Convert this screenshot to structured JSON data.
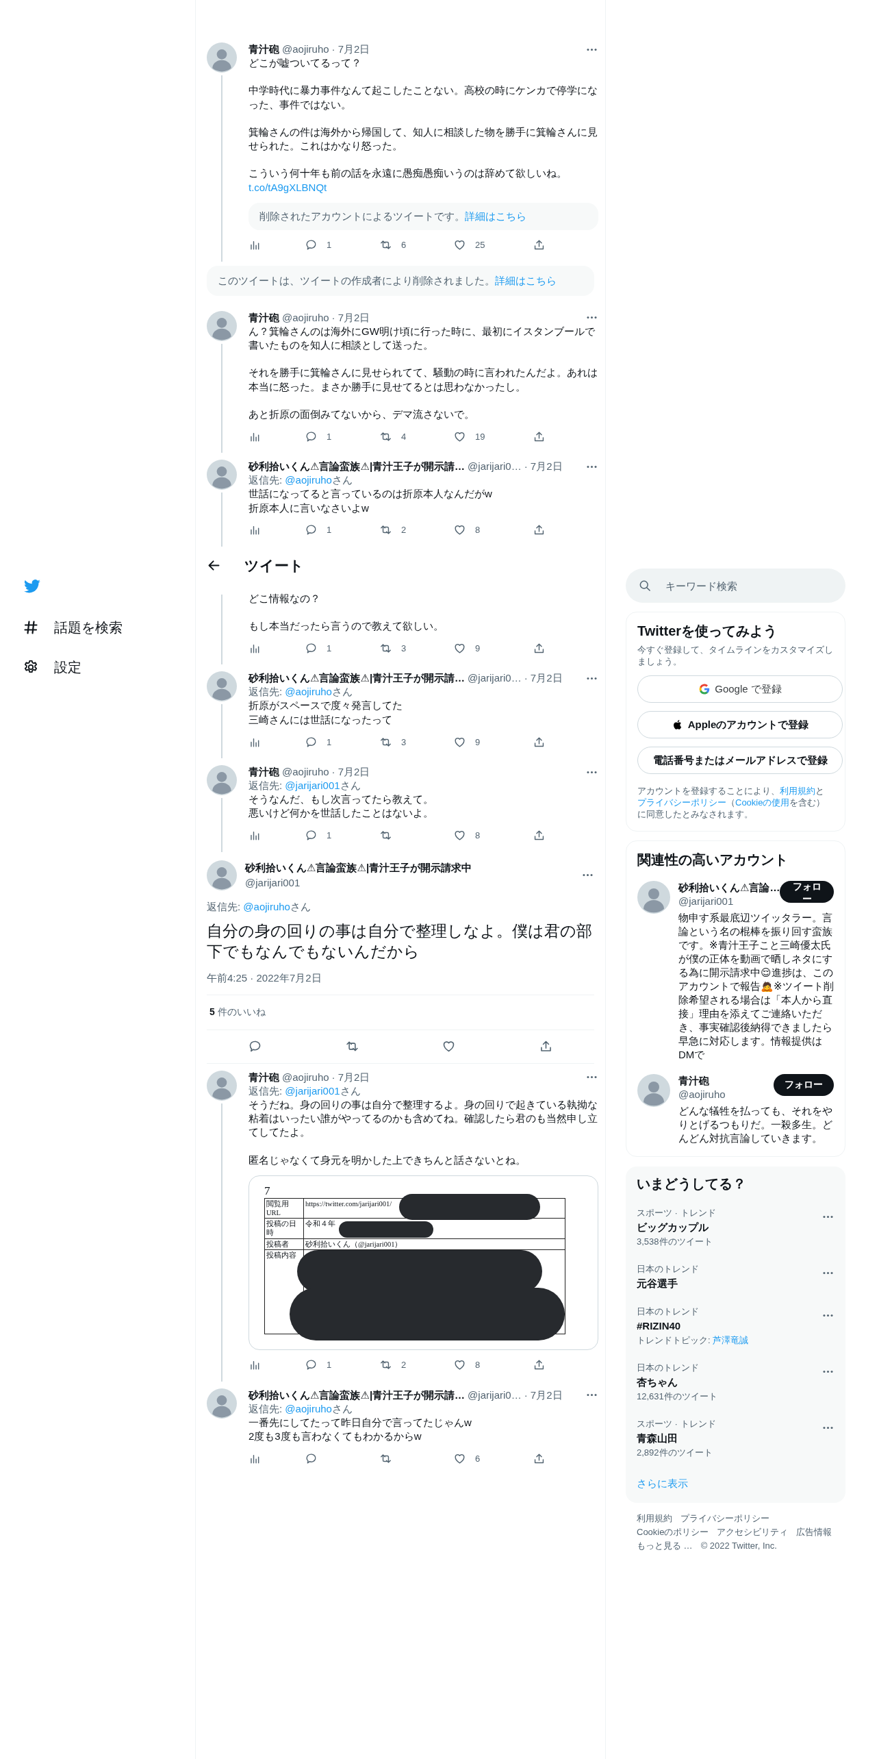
{
  "nav": {
    "items": [
      {
        "kind": "hashtag",
        "label": "話題を検索"
      },
      {
        "kind": "gear",
        "label": "設定"
      }
    ]
  },
  "main": {
    "items": [
      {
        "kind": "tweet",
        "name": "青汁砲",
        "handle": "@aojiruho",
        "date": "· 7月2日",
        "body": [
          [
            "どこが嘘ついてるって？"
          ],
          [
            "中学時代に暴力事件なんて起こしたことない。高校の時にケンカで停学になった、事件ではない。"
          ],
          [
            "箕輪さんの件は海外から帰国して、知人に相談した物を勝手に箕輪さんに見せられた。これはかなり怒った。"
          ],
          [
            "こういう何十年も前の話を永遠に愚痴愚痴いうのは辞めて欲しいね。"
          ]
        ],
        "link": "t.co/tA9gXLBNQt",
        "quote": {
          "text": "削除されたアカウントによるツイートです。",
          "link": "詳細はこちら"
        },
        "thread_line": true,
        "actions": [
          {
            "kind": "analytics"
          },
          {
            "kind": "reply",
            "count": "1"
          },
          {
            "kind": "retweet",
            "count": "6"
          },
          {
            "kind": "like",
            "count": "25"
          },
          {
            "kind": "share"
          }
        ]
      },
      {
        "kind": "notice",
        "text": "このツイートは、ツイートの作成者により削除されました。",
        "link": "詳細はこちら"
      },
      {
        "kind": "tweet",
        "name": "青汁砲",
        "handle": "@aojiruho",
        "date": "· 7月2日",
        "body": [
          [
            "ん？箕輪さんのは海外にGW明け頃に行った時に、最初にイスタンブールで書いたものを知人に相談として送った。"
          ],
          [
            "それを勝手に箕輪さんに見せられてて、騒動の時に言われたんだよ。あれは本当に怒った。まさか勝手に見せてるとは思わなかったし。"
          ],
          [
            "あと折原の面倒みてないから、デマ流さないで。"
          ]
        ],
        "thread_line": true,
        "actions": [
          {
            "kind": "analytics"
          },
          {
            "kind": "reply",
            "count": "1"
          },
          {
            "kind": "retweet",
            "count": "4"
          },
          {
            "kind": "like",
            "count": "19"
          },
          {
            "kind": "share"
          }
        ]
      },
      {
        "kind": "tweet",
        "name": "砂利拾いくん⚠言論蛮族⚠|青汁王子が開示請…",
        "handle": "@jarijari0…",
        "date": "· 7月2日",
        "reply_to": {
          "prefix": "返信先: ",
          "handle": "@aojiruho",
          "suffix": "さん"
        },
        "body": [
          [
            "世話になってると言っているのは折原本人なんだがw",
            "折原本人に言いなさいよw"
          ]
        ],
        "thread_line": true,
        "actions": [
          {
            "kind": "analytics"
          },
          {
            "kind": "reply",
            "count": "1"
          },
          {
            "kind": "retweet",
            "count": "2"
          },
          {
            "kind": "like",
            "count": "8"
          },
          {
            "kind": "share"
          }
        ]
      },
      {
        "kind": "header",
        "title": "ツイート"
      },
      {
        "kind": "tweet",
        "body": [
          [
            "どこ情報なの？"
          ],
          [
            "もし本当だったら言うので教えて欲しい。"
          ]
        ],
        "thread_line": true,
        "actions": [
          {
            "kind": "analytics"
          },
          {
            "kind": "reply",
            "count": "1"
          },
          {
            "kind": "retweet",
            "count": "3"
          },
          {
            "kind": "like",
            "count": "9"
          },
          {
            "kind": "share"
          }
        ]
      },
      {
        "kind": "tweet",
        "name": "砂利拾いくん⚠言論蛮族⚠|青汁王子が開示請…",
        "handle": "@jarijari0…",
        "date": "· 7月2日",
        "reply_to": {
          "prefix": "返信先: ",
          "handle": "@aojiruho",
          "suffix": "さん"
        },
        "body": [
          [
            "折原がスペースで度々発言してた",
            "三崎さんには世話になったって"
          ]
        ],
        "thread_line": true,
        "actions": [
          {
            "kind": "analytics"
          },
          {
            "kind": "reply",
            "count": "1"
          },
          {
            "kind": "retweet",
            "count": "3"
          },
          {
            "kind": "like",
            "count": "9"
          },
          {
            "kind": "share"
          }
        ]
      },
      {
        "kind": "tweet",
        "name": "青汁砲",
        "handle": "@aojiruho",
        "date": "· 7月2日",
        "reply_to": {
          "prefix": "返信先: ",
          "handle": "@jarijari001",
          "suffix": "さん"
        },
        "body": [
          [
            "そうなんだ、もし次言ってたら教えて。",
            "悪いけど何かを世話したことはないよ。"
          ]
        ],
        "thread_line": true,
        "actions": [
          {
            "kind": "analytics"
          },
          {
            "kind": "reply",
            "count": "1"
          },
          {
            "kind": "retweet"
          },
          {
            "kind": "like",
            "count": "8"
          },
          {
            "kind": "share"
          }
        ]
      },
      {
        "kind": "focus",
        "name": "砂利拾いくん⚠言論蛮族⚠|青汁王子が開示請求中",
        "handle": "@jarijari001",
        "reply_to": {
          "prefix": "返信先: ",
          "handle": "@aojiruho",
          "suffix": "さん"
        },
        "body": "自分の身の回りの事は自分で整理しなよ。僕は君の部下でもなんでもないんだから",
        "time": "午前4:25 · 2022年7月2日",
        "likes_count": "5",
        "likes_label": "件のいいね",
        "actions": [
          {
            "kind": "reply"
          },
          {
            "kind": "retweet"
          },
          {
            "kind": "like"
          },
          {
            "kind": "share"
          }
        ]
      },
      {
        "kind": "tweet",
        "name": "青汁砲",
        "handle": "@aojiruho",
        "date": "· 7月2日",
        "reply_to": {
          "prefix": "返信先: ",
          "handle": "@jarijari001",
          "suffix": "さん"
        },
        "body": [
          [
            "そうだね。身の回りの事は自分で整理するよ。身の回りで起きている執拗な粘着はいったい誰がやってるのかも含めてね。確認したら君のも当然申し立てしてたよ。"
          ],
          [
            "匿名じゃなくて身元を明かした上できちんと話さないとね。"
          ]
        ],
        "media": {
          "kind": "document",
          "number": "7",
          "rows": [
            {
              "label": "閲覧用URL",
              "value": "https://twitter.com/jarijari001/"
            },
            {
              "label": "投稿の日時",
              "value": "令和４年"
            },
            {
              "label": "投稿者",
              "value": "砂利拾いくん（@jarijari001）"
            },
            {
              "label": "投稿内容"
            }
          ]
        },
        "thread_line": true,
        "actions": [
          {
            "kind": "analytics"
          },
          {
            "kind": "reply",
            "count": "1"
          },
          {
            "kind": "retweet",
            "count": "2"
          },
          {
            "kind": "like",
            "count": "8"
          },
          {
            "kind": "share"
          }
        ]
      },
      {
        "kind": "tweet",
        "name": "砂利拾いくん⚠言論蛮族⚠|青汁王子が開示請…",
        "handle": "@jarijari0…",
        "date": "· 7月2日",
        "reply_to": {
          "prefix": "返信先: ",
          "handle": "@aojiruho",
          "suffix": "さん"
        },
        "body": [
          [
            "一番先にしてたって昨日自分で言ってたじゃんw",
            "2度も3度も言わなくてもわかるからw"
          ]
        ],
        "thread_line": false,
        "actions": [
          {
            "kind": "analytics"
          },
          {
            "kind": "reply"
          },
          {
            "kind": "retweet"
          },
          {
            "kind": "like",
            "count": "6"
          },
          {
            "kind": "share"
          }
        ]
      }
    ]
  },
  "search": {
    "placeholder": "キーワード検索"
  },
  "signup": {
    "title": "Twitterを使ってみよう",
    "subtitle": "今すぐ登録して、タイムラインをカスタマイズしましょう。",
    "buttons": [
      {
        "kind": "google",
        "label": "Google で登録"
      },
      {
        "kind": "apple",
        "label": "Appleのアカウントで登録"
      },
      {
        "kind": "plain",
        "label": "電話番号またはメールアドレスで登録"
      }
    ],
    "legal": [
      {
        "kind": "text",
        "text": "アカウントを登録することにより、"
      },
      {
        "kind": "link",
        "text": "利用規約"
      },
      {
        "kind": "text",
        "text": "と"
      },
      {
        "kind": "link",
        "text": "プライバシーポリシー"
      },
      {
        "kind": "text",
        "text": "（"
      },
      {
        "kind": "link",
        "text": "Cookieの使用"
      },
      {
        "kind": "text",
        "text": "を含む）に同意したとみなされます。"
      }
    ]
  },
  "follow": {
    "title": "関連性の高いアカウント",
    "accounts": [
      {
        "name": "砂利拾いくん⚠言論…",
        "handle": "@jarijari001",
        "button": "フォロー",
        "bio": "物申す系最底辺ツイッタラー。言論という名の棍棒を振り回す蛮族です。※青汁王子こと三崎優太氏が僕の正体を動画で晒しネタにする為に開示請求中😌進捗は、このアカウントで報告🙇※ツイート削除希望される場合は「本人から直接」理由を添えてご連絡いただき、事実確認後納得できましたら早急に対応します。情報提供はDMで"
      },
      {
        "name": "青汁砲",
        "handle": "@aojiruho",
        "button": "フォロー",
        "bio": "どんな犠牲を払っても、それをやりとげるつもりだ。一殺多生。どんどん対抗言論していきます。"
      }
    ]
  },
  "trends": {
    "title": "いまどうしてる？",
    "items": [
      {
        "context": "スポーツ · トレンド",
        "title": "ビッグカップル",
        "count": "3,538件のツイート"
      },
      {
        "context": "日本のトレンド",
        "title": "元谷選手"
      },
      {
        "context": "日本のトレンド",
        "title": "#RIZIN40",
        "topic_label": "トレンドトピック: ",
        "topic": "芦澤竜誠"
      },
      {
        "context": "日本のトレンド",
        "title": "杏ちゃん",
        "count": "12,631件のツイート"
      },
      {
        "context": "スポーツ · トレンド",
        "title": "青森山田",
        "count": "2,892件のツイート"
      }
    ],
    "more": "さらに表示"
  },
  "footer": {
    "links": [
      "利用規約",
      "プライバシーポリシー",
      "Cookieのポリシー",
      "アクセシビリティ",
      "広告情報",
      "もっと見る …"
    ],
    "copyright": "© 2022 Twitter, Inc."
  }
}
